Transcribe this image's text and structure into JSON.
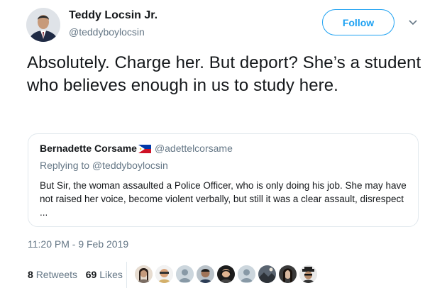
{
  "author": {
    "name": "Teddy Locsin Jr.",
    "handle": "@teddyboylocsin",
    "avatar_icon": "profile-photo"
  },
  "follow_label": "Follow",
  "caret_icon": "chevron-down-icon",
  "tweet": {
    "text": "Absolutely. Charge her. But deport? She’s a student who believes enough in us to study here."
  },
  "quote": {
    "name": "Bernadette Corsame",
    "flag_icon": "philippine-flag-icon",
    "handle": "@adettelcorsame",
    "replying_to": "Replying to @teddyboylocsin",
    "text": "But Sir, the woman assaulted a Police Officer, who is only doing his job. She may have not raised her voice, become violent verbally, but still it was a clear assault, disrespect ..."
  },
  "timestamp": "11:20 PM - 9 Feb 2019",
  "stats": {
    "retweets_count": "8",
    "retweets_label": "Retweets",
    "likes_count": "69",
    "likes_label": "Likes"
  },
  "colors": {
    "accent": "#1da1f2",
    "secondary_text": "#657786",
    "border": "#e1e8ed"
  }
}
